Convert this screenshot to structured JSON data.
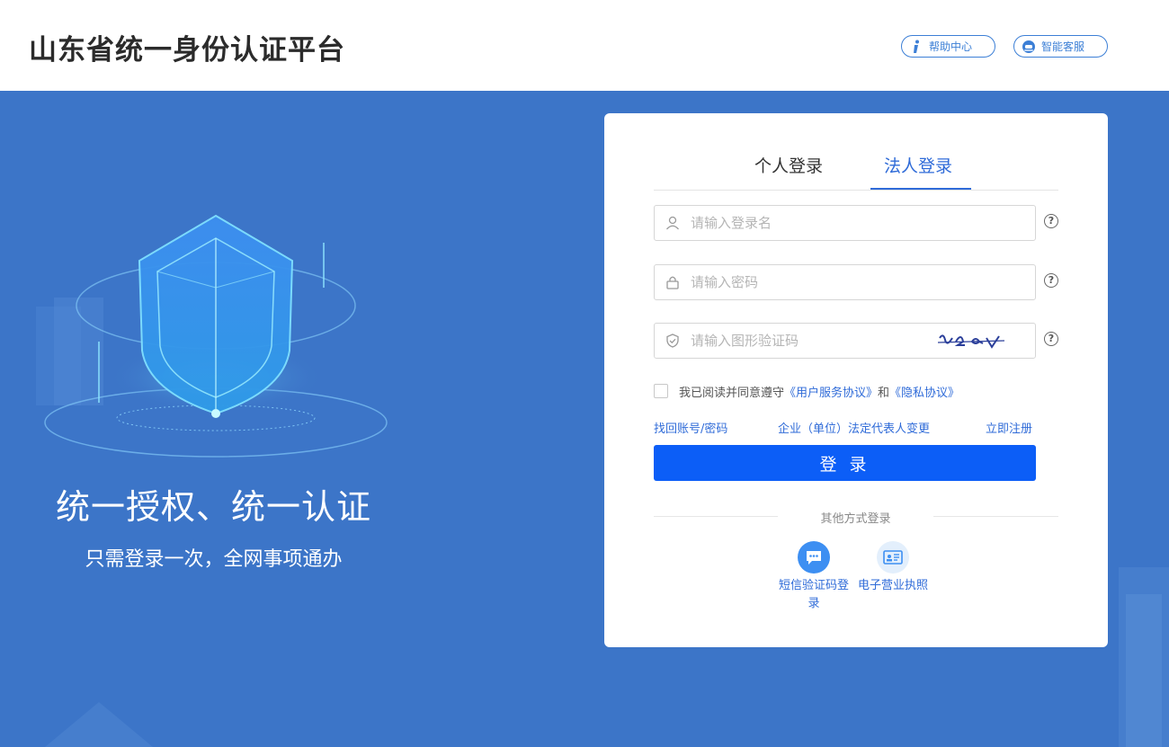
{
  "header": {
    "title": "山东省统一身份认证平台",
    "help_label": "帮助中心",
    "service_label": "智能客服"
  },
  "hero": {
    "slogan": "统一授权、统一认证",
    "subslogan": "只需登录一次，全网事项通办"
  },
  "login": {
    "tabs": [
      {
        "label": "个人登录",
        "active": false
      },
      {
        "label": "法人登录",
        "active": true
      }
    ],
    "username_placeholder": "请输入登录名",
    "password_placeholder": "请输入密码",
    "captcha_placeholder": "请输入图形验证码",
    "help_glyph": "?",
    "agree": {
      "prefix": "我已阅读并同意遵守",
      "service_link": "《用户服务协议》",
      "and": "和",
      "privacy_link": "《隐私协议》"
    },
    "links": {
      "recover": "找回账号/密码",
      "legal_change": "企业（单位）法定代表人变更",
      "register": "立即注册"
    },
    "submit_label": "登 录",
    "other_title": "其他方式登录",
    "alt_methods": [
      {
        "label": "短信验证码登录",
        "icon": "sms-icon"
      },
      {
        "label": "电子营业执照",
        "icon": "license-icon"
      }
    ]
  },
  "colors": {
    "background": "#3c75c8",
    "accent": "#2f6bd8",
    "button": "#0c5ef7"
  }
}
